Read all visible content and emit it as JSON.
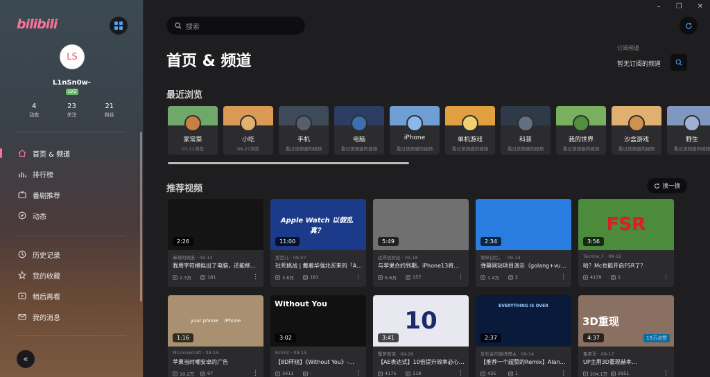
{
  "sidebar": {
    "logo": "bilibili",
    "user": {
      "initials": "LS",
      "name": "L1nSn0w-",
      "level": "LV2"
    },
    "stats": [
      {
        "num": "4",
        "label": "动态"
      },
      {
        "num": "23",
        "label": "关注"
      },
      {
        "num": "21",
        "label": "粉丝"
      }
    ],
    "nav_main": [
      "首页 & 频道",
      "排行榜",
      "番剧推荐",
      "动态"
    ],
    "nav_secondary": [
      "历史记录",
      "我的收藏",
      "稍后再看",
      "我的消息"
    ],
    "collapse_icon": "«"
  },
  "main": {
    "search_placeholder": "搜索",
    "title": "首页 & 频道",
    "sub_label": "订阅频道",
    "sub_status": "暂无订阅的频道",
    "recent_title": "最近浏览",
    "recommend_title": "推荐视频",
    "refresh_label": "换一换",
    "window_controls": [
      "–",
      "❐",
      "✕"
    ],
    "channels": [
      {
        "name": "家常菜",
        "sub": "07-11浏览",
        "banner": "#6fa86a",
        "icon": "#c88040"
      },
      {
        "name": "小吃",
        "sub": "06-27浏览",
        "banner": "#d99a55",
        "icon": "#e3b070"
      },
      {
        "name": "手机",
        "sub": "看过该频道的视频",
        "banner": "#3e4a58",
        "icon": "#55606c"
      },
      {
        "name": "电脑",
        "sub": "看过该频道的视频",
        "banner": "#2b3d62",
        "icon": "#3a70b0"
      },
      {
        "name": "iPhone",
        "sub": "看过该频道的视频",
        "banner": "#6f9ed4",
        "icon": "#8ab8e8"
      },
      {
        "name": "单机游戏",
        "sub": "看过该频道的视频",
        "banner": "#e0a040",
        "icon": "#f0d070"
      },
      {
        "name": "科普",
        "sub": "看过该频道的视频",
        "banner": "#2e3a48",
        "icon": "#607080"
      },
      {
        "name": "我的世界",
        "sub": "看过该频道的视频",
        "banner": "#78b060",
        "icon": "#509040"
      },
      {
        "name": "沙盒游戏",
        "sub": "看过该频道的视频",
        "banner": "#e0b070",
        "icon": "#d09050"
      },
      {
        "name": "野生",
        "sub": "看过该频道的视频",
        "banner": "#8098c0",
        "icon": "#a0b0d0"
      }
    ],
    "videos": [
      {
        "duration": "2:26",
        "meta": "麻辣的网友 · 09-13",
        "title": "我用字符模拟出了电脑，还能移…",
        "views": "2.3万",
        "danmaku": "181",
        "bg": "#141414",
        "overlay": ""
      },
      {
        "duration": "11:00",
        "meta": "爱范儿 · 09-07",
        "title": "社死挑战 | 戴着华强北买来的「A…",
        "views": "3.6万",
        "danmaku": "181",
        "bg": "#1b3a8a",
        "overlay": "Apple Watch 以假乱真？"
      },
      {
        "duration": "5:49",
        "meta": "远哥说财经 · 09-18",
        "title": "与苹果合约到期，iPhone13将…",
        "views": "6.6万",
        "danmaku": "157",
        "bg": "#707070",
        "overlay": ""
      },
      {
        "duration": "2:34",
        "meta": "零碎记忆。 · 09-14",
        "title": "弹幕网站项目演示（golang+vu…",
        "views": "1.4万",
        "danmaku": "2",
        "bg": "#2a7de0",
        "overlay": ""
      },
      {
        "duration": "3:56",
        "meta": "Tacrine_F · 09-12",
        "title": "哈？Mc也能开启FSR了？",
        "views": "4139",
        "danmaku": "1",
        "bg": "#4c8a3c",
        "overlay": "FSR"
      },
      {
        "duration": "1:16",
        "meta": "MCminecraft · 09-15",
        "title": "苹果当时嘲安卓的广告",
        "views": "10.2万",
        "danmaku": "97",
        "bg": "#a89070",
        "overlay": "your phone    iPhone"
      },
      {
        "duration": "3:02",
        "meta": "EchYZ · 09-15",
        "title": "【8D环绕】《Without You》-…",
        "views": "3411",
        "danmaku": "-",
        "bg": "#111111",
        "overlay": "Without You"
      },
      {
        "duration": "3:41",
        "meta": "蟹萝葛诺 · 09-28",
        "title": "【AE表达式】10倍提升效率必心…",
        "views": "4175",
        "danmaku": "118",
        "bg": "#e8e8f0",
        "overlay": "10"
      },
      {
        "duration": "2:37",
        "meta": "反社会的微博博主 · 09-14",
        "title": "【推荐一个超赞的Remix】Alan…",
        "views": "435",
        "danmaku": "1",
        "bg": "#0a1a3a",
        "overlay": "EVERYTHING IS OVER"
      },
      {
        "duration": "4:37",
        "meta": "鲁茶哥 · 09-17",
        "title": "UP主用3D重现赫本…",
        "views": "204.1万",
        "danmaku": "2951",
        "bg": "#8a7060",
        "overlay": "3D重现",
        "badge": "19万点赞"
      }
    ]
  },
  "colors": {
    "accent": "#fb7299",
    "level": "#64b864"
  }
}
